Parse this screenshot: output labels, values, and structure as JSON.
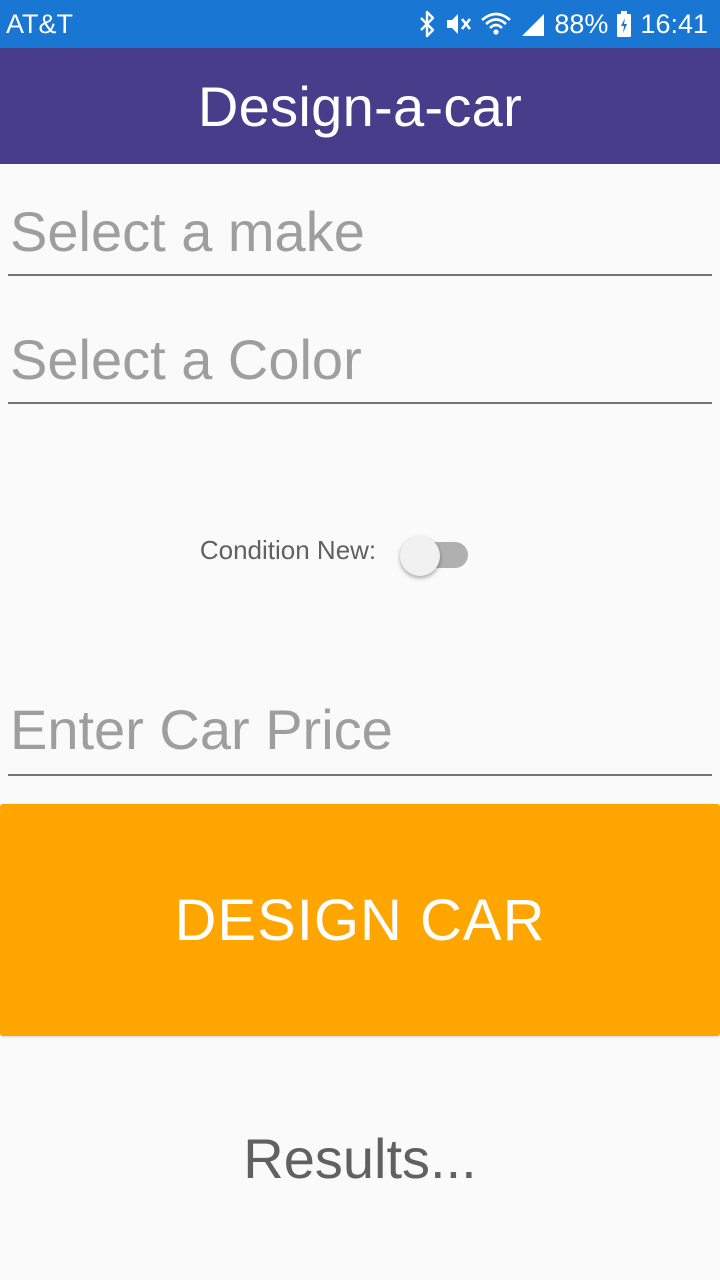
{
  "status_bar": {
    "carrier": "AT&T",
    "battery": "88%",
    "time": "16:41",
    "icons": [
      "bluetooth-icon",
      "mute-icon",
      "wifi-icon",
      "signal-icon",
      "battery-charging-icon"
    ],
    "background": "#1976d2"
  },
  "app_bar": {
    "title": "Design-a-car",
    "background": "#483d8b"
  },
  "form": {
    "make_picker": {
      "placeholder": "Select a make"
    },
    "color_picker": {
      "placeholder": "Select a Color"
    },
    "condition": {
      "label": "Condition New:",
      "toggled": false
    },
    "price_input": {
      "value": "",
      "placeholder": "Enter Car Price"
    },
    "design_button": {
      "label": "DESIGN CAR",
      "background": "#ffa500"
    }
  },
  "results": {
    "text": "Results..."
  }
}
